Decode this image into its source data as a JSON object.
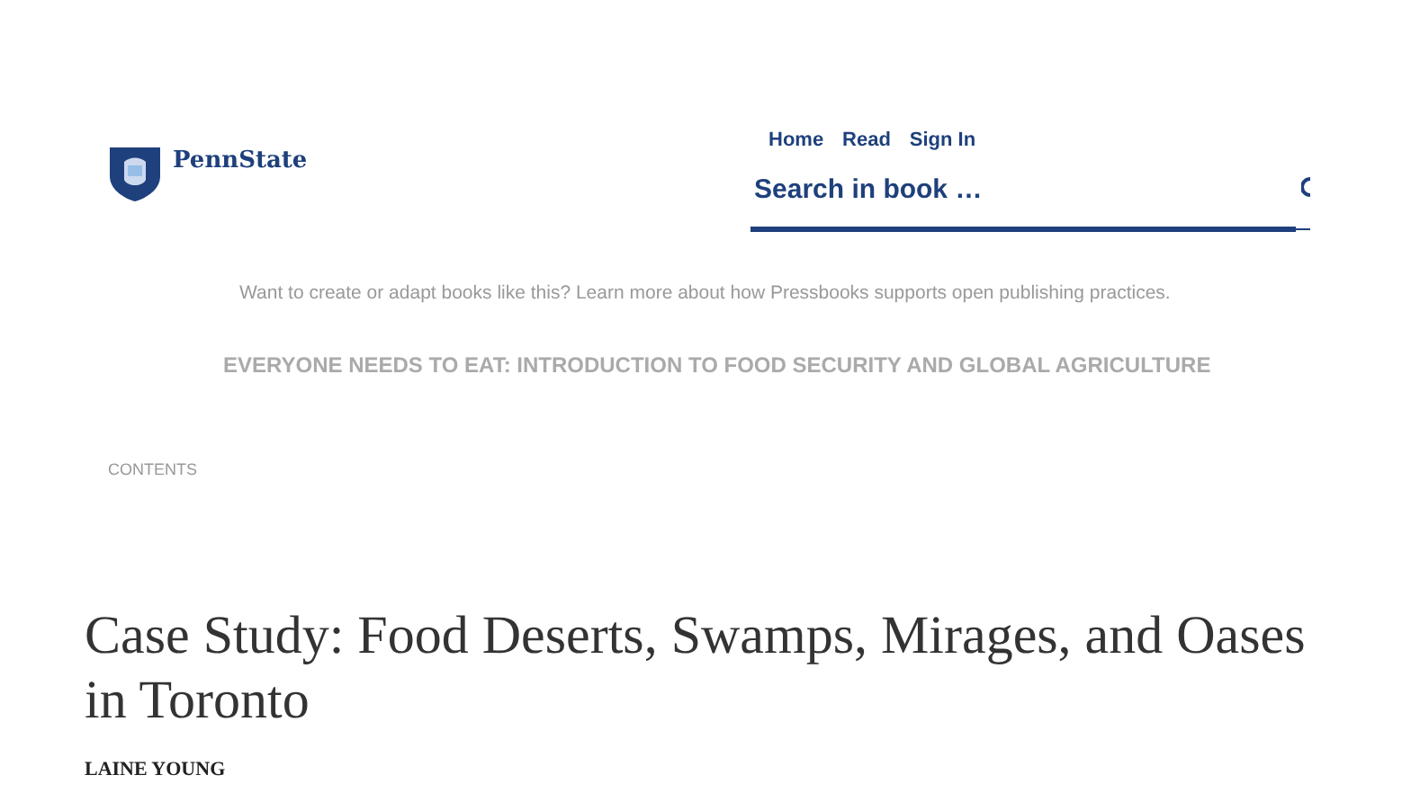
{
  "header": {
    "logo": {
      "text": "PennState"
    },
    "nav": [
      {
        "label": "Home"
      },
      {
        "label": "Read"
      },
      {
        "label": "Sign In"
      }
    ],
    "search": {
      "placeholder": "Search in book …"
    }
  },
  "notice": "Want to create or adapt books like this? Learn more about how Pressbooks supports open publishing practices.",
  "book_title": "EVERYONE NEEDS TO EAT: INTRODUCTION TO FOOD SECURITY AND GLOBAL AGRICULTURE",
  "contents_toggle": "CONTENTS",
  "chapter": {
    "title": "Case Study: Food Deserts, Swamps, Mirages, and Oases in Toronto",
    "author": "LAINE YOUNG"
  }
}
